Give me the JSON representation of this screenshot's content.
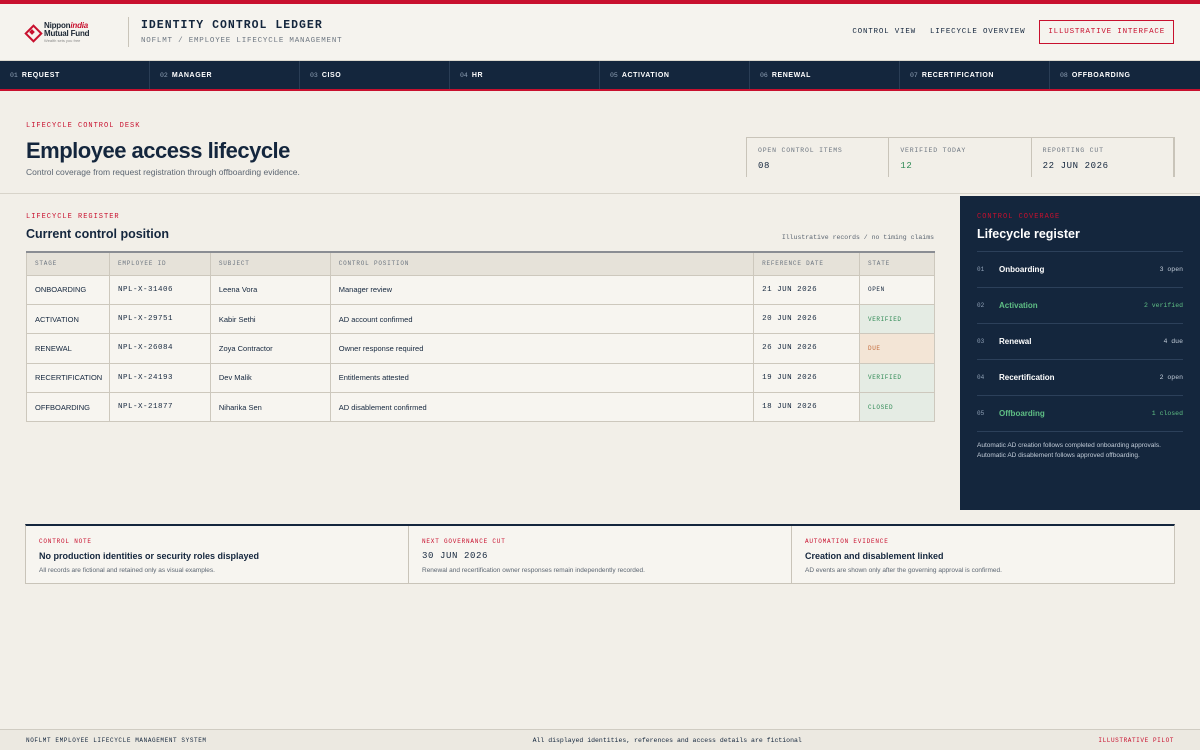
{
  "brand": {
    "logo_line1a": "Nippon",
    "logo_line1b": "india",
    "logo_line2": "Mutual Fund",
    "logo_tagline": "Wealth sets you free",
    "accent": "#c8102e",
    "navy": "#14263d"
  },
  "header": {
    "title": "IDENTITY CONTROL LEDGER",
    "subtitle": "NOFLMT / EMPLOYEE LIFECYCLE MANAGEMENT",
    "nav": [
      "CONTROL VIEW",
      "LIFECYCLE OVERVIEW"
    ],
    "cta": "ILLUSTRATIVE INTERFACE"
  },
  "steps": [
    {
      "num": "01",
      "label": "REQUEST"
    },
    {
      "num": "02",
      "label": "MANAGER"
    },
    {
      "num": "03",
      "label": "CISO"
    },
    {
      "num": "04",
      "label": "HR"
    },
    {
      "num": "05",
      "label": "ACTIVATION"
    },
    {
      "num": "06",
      "label": "RENEWAL"
    },
    {
      "num": "07",
      "label": "RECERTIFICATION"
    },
    {
      "num": "08",
      "label": "OFFBOARDING"
    }
  ],
  "hero": {
    "eyebrow": "LIFECYCLE CONTROL DESK",
    "title": "Employee access lifecycle",
    "subtitle": "Control coverage from request registration through offboarding evidence.",
    "kpis": [
      {
        "label": "OPEN CONTROL ITEMS",
        "value": "08"
      },
      {
        "label": "VERIFIED TODAY",
        "value": "12"
      },
      {
        "label": "REPORTING CUT",
        "value": "22 JUN 2026"
      }
    ]
  },
  "register": {
    "eyebrow": "LIFECYCLE REGISTER",
    "title": "Current control position",
    "note": "Illustrative records / no timing claims",
    "columns": [
      "STAGE",
      "EMPLOYEE ID",
      "SUBJECT",
      "CONTROL POSITION",
      "REFERENCE DATE",
      "STATE"
    ],
    "rows": [
      {
        "stage": "ONBOARDING",
        "id": "NPL-X-31406",
        "subject": "Leena Vora",
        "position": "Manager review",
        "date": "21 JUN 2026",
        "state": "OPEN"
      },
      {
        "stage": "ACTIVATION",
        "id": "NPL-X-29751",
        "subject": "Kabir Sethi",
        "position": "AD account confirmed",
        "date": "20 JUN 2026",
        "state": "VERIFIED"
      },
      {
        "stage": "RENEWAL",
        "id": "NPL-X-26084",
        "subject": "Zoya Contractor",
        "position": "Owner response required",
        "date": "26 JUN 2026",
        "state": "DUE"
      },
      {
        "stage": "RECERTIFICATION",
        "id": "NPL-X-24193",
        "subject": "Dev Malik",
        "position": "Entitlements attested",
        "date": "19 JUN 2026",
        "state": "VERIFIED"
      },
      {
        "stage": "OFFBOARDING",
        "id": "NPL-X-21877",
        "subject": "Niharika Sen",
        "position": "AD disablement confirmed",
        "date": "18 JUN 2026",
        "state": "CLOSED"
      }
    ]
  },
  "coverage": {
    "eyebrow": "CONTROL COVERAGE",
    "title": "Lifecycle register",
    "items": [
      {
        "num": "01",
        "name": "Onboarding",
        "count": "3 open"
      },
      {
        "num": "02",
        "name": "Activation",
        "count": "2 verified"
      },
      {
        "num": "03",
        "name": "Renewal",
        "count": "4 due"
      },
      {
        "num": "04",
        "name": "Recertification",
        "count": "2 open"
      },
      {
        "num": "05",
        "name": "Offboarding",
        "count": "1 closed"
      }
    ],
    "foot1": "Automatic AD creation follows completed onboarding approvals.",
    "foot2": "Automatic AD disablement follows approved offboarding."
  },
  "notes": [
    {
      "label": "CONTROL NOTE",
      "title": "No production identities or security roles displayed",
      "text": "All records are fictional and retained only as visual examples."
    },
    {
      "label": "NEXT GOVERNANCE CUT",
      "title": "30 JUN 2026",
      "text": "Renewal and recertification owner responses remain independently recorded."
    },
    {
      "label": "AUTOMATION EVIDENCE",
      "title": "Creation and disablement linked",
      "text": "AD events are shown only after the governing approval is confirmed."
    }
  ],
  "footer": {
    "left": "NOFLMT EMPLOYEE LIFECYCLE MANAGEMENT SYSTEM",
    "center": "All displayed identities, references and access details are fictional",
    "right": "ILLUSTRATIVE PILOT"
  }
}
